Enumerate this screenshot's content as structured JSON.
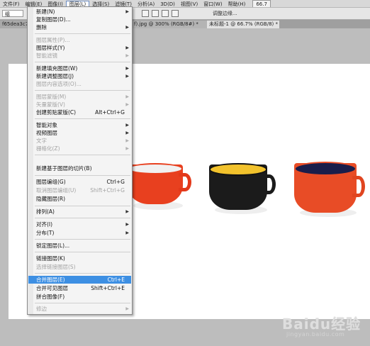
{
  "menubar": {
    "items": [
      {
        "label": "文件(F)"
      },
      {
        "label": "编辑(E)"
      },
      {
        "label": "图像(I)"
      },
      {
        "label": "图层(L)"
      },
      {
        "label": "选择(S)"
      },
      {
        "label": "滤镜(T)"
      },
      {
        "label": "分析(A)"
      },
      {
        "label": "3D(D)"
      },
      {
        "label": "视图(V)"
      },
      {
        "label": "窗口(W)"
      },
      {
        "label": "帮助(H)"
      }
    ],
    "zoom": "66.7"
  },
  "options": {
    "preset": "组",
    "refine": "调整边缘..."
  },
  "tabs": [
    {
      "label": "f65dea3c7413"
    },
    {
      "label": "f).jpg @ 300% (RGB/8#) *"
    },
    {
      "label": "未标题-1 @ 66.7% (RGB/8) *"
    }
  ],
  "layer_menu": {
    "items": [
      {
        "label": "新建(N)",
        "shortcut": "",
        "submenu": true,
        "disabled": false
      },
      {
        "label": "复制图层(D)...",
        "shortcut": "",
        "submenu": false,
        "disabled": false
      },
      {
        "label": "删除",
        "shortcut": "",
        "submenu": true,
        "disabled": false
      },
      {
        "label": "图层属性(P)...",
        "shortcut": "",
        "submenu": false,
        "disabled": true
      },
      {
        "label": "图层样式(Y)",
        "shortcut": "",
        "submenu": true,
        "disabled": false
      },
      {
        "label": "智能滤镜",
        "shortcut": "",
        "submenu": true,
        "disabled": true
      },
      {
        "label": "新建填充图层(W)",
        "shortcut": "",
        "submenu": true,
        "disabled": false
      },
      {
        "label": "新建调整图层(J)",
        "shortcut": "",
        "submenu": true,
        "disabled": false
      },
      {
        "label": "图层内容选项(O)...",
        "shortcut": "",
        "submenu": false,
        "disabled": true
      },
      {
        "label": "图层蒙版(M)",
        "shortcut": "",
        "submenu": true,
        "disabled": true
      },
      {
        "label": "矢量蒙版(V)",
        "shortcut": "",
        "submenu": true,
        "disabled": true
      },
      {
        "label": "创建剪贴蒙版(C)",
        "shortcut": "Alt+Ctrl+G",
        "submenu": false,
        "disabled": false
      },
      {
        "label": "智能对象",
        "shortcut": "",
        "submenu": true,
        "disabled": false
      },
      {
        "label": "视频图层",
        "shortcut": "",
        "submenu": true,
        "disabled": false
      },
      {
        "label": "文字",
        "shortcut": "",
        "submenu": true,
        "disabled": true
      },
      {
        "label": "栅格化(Z)",
        "shortcut": "",
        "submenu": true,
        "disabled": true
      },
      {
        "label": "新建基于图层的切片(B)",
        "shortcut": "",
        "submenu": false,
        "disabled": false
      },
      {
        "label": "图层编组(G)",
        "shortcut": "Ctrl+G",
        "submenu": false,
        "disabled": false
      },
      {
        "label": "取消图层编组(U)",
        "shortcut": "Shift+Ctrl+G",
        "submenu": false,
        "disabled": true
      },
      {
        "label": "隐藏图层(R)",
        "shortcut": "",
        "submenu": false,
        "disabled": false
      },
      {
        "label": "排列(A)",
        "shortcut": "",
        "submenu": true,
        "disabled": false
      },
      {
        "label": "对齐(I)",
        "shortcut": "",
        "submenu": true,
        "disabled": false
      },
      {
        "label": "分布(T)",
        "shortcut": "",
        "submenu": true,
        "disabled": false
      },
      {
        "label": "锁定图层(L)...",
        "shortcut": "",
        "submenu": false,
        "disabled": false
      },
      {
        "label": "链接图层(K)",
        "shortcut": "",
        "submenu": false,
        "disabled": false
      },
      {
        "label": "选择链接图层(S)",
        "shortcut": "",
        "submenu": false,
        "disabled": true
      },
      {
        "label": "合并图层(E)",
        "shortcut": "Ctrl+E",
        "submenu": false,
        "disabled": false,
        "highlighted": true
      },
      {
        "label": "合并可见图层",
        "shortcut": "Shift+Ctrl+E",
        "submenu": false,
        "disabled": false
      },
      {
        "label": "拼合图像(F)",
        "shortcut": "",
        "submenu": false,
        "disabled": false
      },
      {
        "label": "修边",
        "shortcut": "",
        "submenu": true,
        "disabled": true
      }
    ]
  },
  "watermark": {
    "brand": "Baidu经验",
    "url": "jingyan.baidu.com"
  },
  "colors": {
    "highlight": "#3d8fe3",
    "cup_red": "#e8401f",
    "cup_black": "#1b1b1b",
    "cup_yellow": "#f2c22c",
    "cup_navy": "#1a1d4a"
  }
}
